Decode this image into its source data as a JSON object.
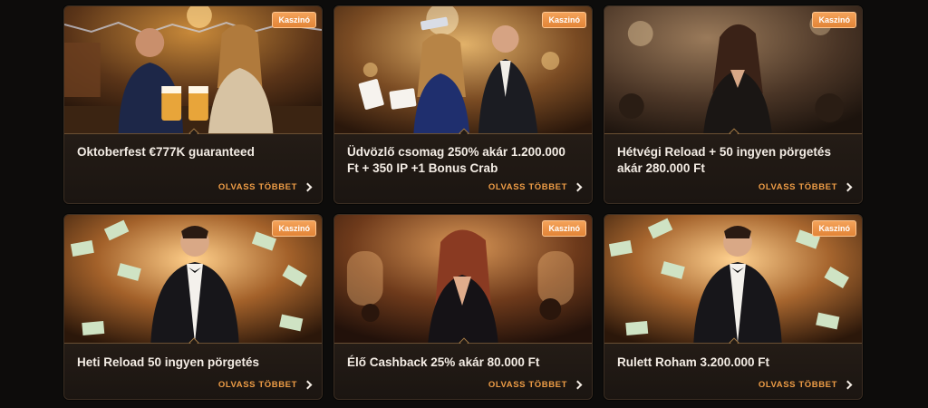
{
  "promos": [
    {
      "badge": "Kaszinó",
      "title": "Oktoberfest €777K guaranteed",
      "cta": "OLVASS TÖBBET"
    },
    {
      "badge": "Kaszinó",
      "title": "Üdvözlő csomag 250% akár 1.200.000 Ft + 350 IP +1 Bonus Crab",
      "cta": "OLVASS TÖBBET"
    },
    {
      "badge": "Kaszinó",
      "title": "Hétvégi Reload + 50 ingyen pörgetés akár 280.000 Ft",
      "cta": "OLVASS TÖBBET"
    },
    {
      "badge": "Kaszinó",
      "title": "Heti Reload 50 ingyen pörgetés",
      "cta": "OLVASS TÖBBET"
    },
    {
      "badge": "Kaszinó",
      "title": "Élő Cashback 25% akár 80.000 Ft",
      "cta": "OLVASS TÖBBET"
    },
    {
      "badge": "Kaszinó",
      "title": "Rulett Roham 3.200.000 Ft",
      "cta": "OLVASS TÖBBET"
    }
  ],
  "colors": {
    "background": "#0d0c0b",
    "card": "#211a15",
    "badge": "#e28437",
    "cta": "#ef9d46",
    "title": "#f3ece4"
  },
  "icons": {
    "cta": "chevron-right-icon"
  }
}
